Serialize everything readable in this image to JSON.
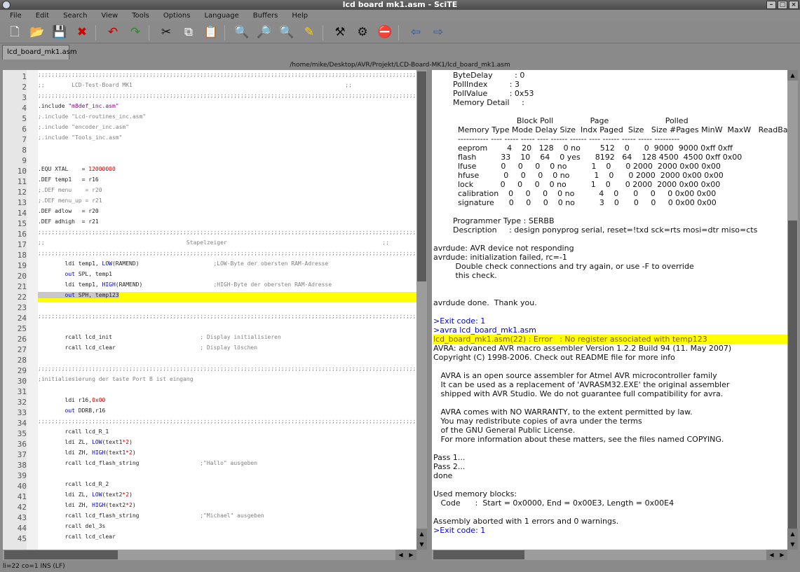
{
  "window": {
    "title": "lcd board mk1.asm - SciTE"
  },
  "menu": [
    "File",
    "Edit",
    "Search",
    "View",
    "Tools",
    "Options",
    "Language",
    "Buffers",
    "Help"
  ],
  "toolbar": [
    "new-file",
    "open-file",
    "save-file",
    "close-file",
    "undo",
    "redo",
    "cut",
    "copy",
    "paste",
    "find",
    "find-next",
    "find-in-files",
    "replace",
    "compile",
    "build",
    "stop",
    "prev-buffer",
    "next-buffer"
  ],
  "tab": {
    "label": "lcd_board_mk1.asm"
  },
  "path": "/home/mike/Desktop/AVR/Projekt/LCD-Board-MK1/lcd_board_mk1.asm",
  "editor": {
    "lines": [
      {
        "n": "1",
        "t": ";;;;;;;;;;;;;;;;;;;;;;;;;;;;;;;;;;;;;;;;;;;;;;;;;;;;;;;;;;;;;;;;;;;;;;;;;;;;;;;;;;;;;;;;;;;;;;;;;;;;;;;;;;;;;;;;;;;;;;;",
        "c": "cm"
      },
      {
        "n": "2",
        "t": ";;        LCD-Test-Board MK1                                                               ;;",
        "c": "cm"
      },
      {
        "n": "3",
        "t": ";;;;;;;;;;;;;;;;;;;;;;;;;;;;;;;;;;;;;;;;;;;;;;;;;;;;;;;;;;;;;;;;;;;;;;;;;;;;;;;;;;;;;;;;;;;;;;;;;;;;;;;;;;;;;;;;;;;;;;;",
        "c": "cm"
      },
      {
        "n": "4",
        "p1": ".include ",
        "p2": "\"m8def_inc.asm\"",
        "c": "inc"
      },
      {
        "n": "5",
        "t": ";.include \"Lcd-routines_inc.asm\"",
        "c": "cm"
      },
      {
        "n": "6",
        "t": ";.include \"encoder_inc.asm\"",
        "c": "cm"
      },
      {
        "n": "7",
        "t": ";.include \"Tools_inc.asm\"",
        "c": "cm"
      },
      {
        "n": "8",
        "t": "",
        "c": ""
      },
      {
        "n": "9",
        "t": "",
        "c": ""
      },
      {
        "n": "10",
        "p1": ".EQU XTAL    = ",
        "p2": "12000000",
        "c": "equ"
      },
      {
        "n": "11",
        "t": ".DEF temp1   = r16",
        "c": "kw"
      },
      {
        "n": "12",
        "t": ";.DEF menu    = r20",
        "c": "cm"
      },
      {
        "n": "13",
        "t": ";.DEF menu_up = r21",
        "c": "cm"
      },
      {
        "n": "14",
        "t": ".DEF adlow   = r20",
        "c": "kw"
      },
      {
        "n": "15",
        "t": ".DEF adhigh  = r21",
        "c": "kw"
      },
      {
        "n": "16",
        "t": ";;;;;;;;;;;;;;;;;;;;;;;;;;;;;;;;;;;;;;;;;;;;;;;;;;;;;;;;;;;;;;;;;;;;;;;;;;;;;;;;;;;;;;;;;;;;;;;;;;;;;;;;;;;;;;;;;;;;;;;",
        "c": "cm"
      },
      {
        "n": "17",
        "t": ";;                                          Stapelzeiger                                              ;;",
        "c": "cm"
      },
      {
        "n": "18",
        "t": ";;;;;;;;;;;;;;;;;;;;;;;;;;;;;;;;;;;;;;;;;;;;;;;;;;;;;;;;;;;;;;;;;;;;;;;;;;;;;;;;;;;;;;;;;;;;;;;;;;;;;;;;;;;;;;;;;;;;;;;",
        "c": "cm"
      },
      {
        "n": "19",
        "p1": "        ldi temp1, ",
        "p2": "LOW",
        "p3": "(RAMEND)                      ",
        "p4": ";LOW-Byte der obersten RAM-Adresse",
        "c": "ldi"
      },
      {
        "n": "20",
        "p1": "        ",
        "p2": "out",
        "p3": " SPL, temp1",
        "c": "out"
      },
      {
        "n": "21",
        "p1": "        ldi temp1, ",
        "p2": "HIGH",
        "p3": "(RAMEND)                     ",
        "p4": ";HIGH-Byte der obersten RAM-Adresse",
        "c": "ldi"
      },
      {
        "n": "22",
        "p1": "        ",
        "p2": "out",
        "p3": " SPH, temp123",
        "c": "out",
        "hl": true
      },
      {
        "n": "23",
        "t": "",
        "c": ""
      },
      {
        "n": "24",
        "t": ";;;;;;;;;;;;;;;;;;;;;;;;;;;;;;;;;;;;;;;;;;;;;;;;;;;;;;;;;;;;;;;;;;;;;;;;;;;;;;;;;;;;;;;;;;;;;;;;;;;;;;;;;;;;;;;;;;;;;;;",
        "c": "cm"
      },
      {
        "n": "25",
        "t": "",
        "c": ""
      },
      {
        "n": "26",
        "p1": "        rcall lcd_init                          ",
        "p4": "; Display initialisieren",
        "c": "rc"
      },
      {
        "n": "27",
        "p1": "        rcall lcd_clear                         ",
        "p4": "; Display löschen",
        "c": "rc"
      },
      {
        "n": "28",
        "t": "",
        "c": ""
      },
      {
        "n": "29",
        "t": ";;;;;;;;;;;;;;;;;;;;;;;;;;;;;;;;;;;;;;;;;;;;;;;;;;;;;;;;;;;;;;;;;;;;;;;;;;;;;;;;;;;;;;;;;;;;;;;;;;;;;;;;;;;;;;;;;;;;;;;",
        "c": "cm"
      },
      {
        "n": "30",
        "t": ";initialiesierung der taste Port B ist eingang",
        "c": "cm"
      },
      {
        "n": "31",
        "t": "",
        "c": ""
      },
      {
        "n": "32",
        "p1": "        ldi r16,",
        "p2": "0x00",
        "c": "num"
      },
      {
        "n": "33",
        "p1": "        ",
        "p2": "out",
        "p3": " DDRB,r16",
        "c": "out"
      },
      {
        "n": "34",
        "t": ";;;;;;;;;;;;;;;;;;;;;;;;;;;;;;;;;;;;;;;;;;;;;;;;;;;;;;;;;;;;;;;;;;;;;;;;;;;;;;;;;;;;;;;;;;;;;;;;;;;;;;;;;;;;;;;;;;;;;;;",
        "c": "cm"
      },
      {
        "n": "35",
        "t": "        rcall lcd_R_1",
        "c": ""
      },
      {
        "n": "36",
        "p1": "        ldi ZL, ",
        "p2": "LOW",
        "p3": "(text1",
        "p5": "*2",
        "p6": ")",
        "c": "ldz"
      },
      {
        "n": "37",
        "p1": "        ldi ZH, ",
        "p2": "HIGH",
        "p3": "(text1",
        "p5": "*2",
        "p6": ")",
        "c": "ldz"
      },
      {
        "n": "38",
        "p1": "        rcall lcd_flash_string                  ",
        "p4": ";\"Hallo\" ausgeben",
        "c": "rc"
      },
      {
        "n": "39",
        "t": "",
        "c": ""
      },
      {
        "n": "40",
        "t": "        rcall lcd_R_2",
        "c": ""
      },
      {
        "n": "41",
        "p1": "        ldi ZL, ",
        "p2": "LOW",
        "p3": "(text2",
        "p5": "*2",
        "p6": ")",
        "c": "ldz"
      },
      {
        "n": "42",
        "p1": "        ldi ZH, ",
        "p2": "HIGH",
        "p3": "(text2",
        "p5": "*2",
        "p6": ")",
        "c": "ldz"
      },
      {
        "n": "43",
        "p1": "        rcall lcd_flash_string                  ",
        "p4": ";\"Michael\" ausgeben",
        "c": "rc"
      },
      {
        "n": "44",
        "t": "        rcall del_3s",
        "c": ""
      },
      {
        "n": "45",
        "t": "        rcall lcd_clear",
        "c": ""
      }
    ]
  },
  "output": {
    "lines": [
      {
        "t": "        ByteDelay         : 0",
        "c": ""
      },
      {
        "t": "        PollIndex         : 3",
        "c": ""
      },
      {
        "t": "        PollValue         : 0x53",
        "c": ""
      },
      {
        "t": "        Memory Detail     :",
        "c": ""
      },
      {
        "t": "",
        "c": ""
      },
      {
        "t": "                                  Block Poll               Page                       Polled",
        "c": ""
      },
      {
        "t": "          Memory Type Mode Delay Size  Indx Paged  Size   Size #Pages MinW  MaxW   ReadBack",
        "c": ""
      },
      {
        "t": "          ----------- ---- ----- ----- ---- ------ ------ ---- ------ ----- ----- ---------",
        "c": ""
      },
      {
        "t": "          eeprom        4    20   128    0 no        512    0      0  9000  9000 0xff 0xff",
        "c": ""
      },
      {
        "t": "          flash          33    10    64    0 yes      8192   64    128 4500  4500 0xff 0x00",
        "c": ""
      },
      {
        "t": "          lfuse          0     0     0    0 no          1    0      0 2000  2000 0x00 0x00",
        "c": ""
      },
      {
        "t": "          hfuse          0     0     0    0 no          1    0      0 2000  2000 0x00 0x00",
        "c": ""
      },
      {
        "t": "          lock           0     0     0    0 no          1    0      0 2000  2000 0x00 0x00",
        "c": ""
      },
      {
        "t": "          calibration    0     0     0    0 no          4    0      0     0     0 0x00 0x00",
        "c": ""
      },
      {
        "t": "          signature      0     0     0    0 no          3    0      0     0     0 0x00 0x00",
        "c": ""
      },
      {
        "t": "",
        "c": ""
      },
      {
        "t": "        Programmer Type : SERBB",
        "c": ""
      },
      {
        "t": "        Description     : design ponyprog serial, reset=!txd sck=rts mosi=dtr miso=cts",
        "c": ""
      },
      {
        "t": "",
        "c": ""
      },
      {
        "t": "avrdude: AVR device not responding",
        "c": ""
      },
      {
        "t": "avrdude: initialization failed, rc=-1",
        "c": ""
      },
      {
        "t": "         Double check connections and try again, or use -F to override",
        "c": ""
      },
      {
        "t": "         this check.",
        "c": ""
      },
      {
        "t": "",
        "c": ""
      },
      {
        "t": "",
        "c": ""
      },
      {
        "t": "avrdude done.  Thank you.",
        "c": ""
      },
      {
        "t": "",
        "c": ""
      },
      {
        "t": ">Exit code: 1",
        "c": "ex"
      },
      {
        "t": ">avra lcd_board_mk1.asm",
        "c": "ex"
      },
      {
        "t": "lcd_board_mk1.asm(22) : Error   : No register associated with temp123",
        "c": "err"
      },
      {
        "t": "AVRA: advanced AVR macro assembler Version 1.2.2 Build 94 (11. May 2007)",
        "c": ""
      },
      {
        "t": "Copyright (C) 1998-2006. Check out README file for more info",
        "c": ""
      },
      {
        "t": "",
        "c": ""
      },
      {
        "t": "   AVRA is an open source assembler for Atmel AVR microcontroller family",
        "c": ""
      },
      {
        "t": "   It can be used as a replacement of 'AVRASM32.EXE' the original assembler",
        "c": ""
      },
      {
        "t": "   shipped with AVR Studio. We do not guarantee full compatibility for avra.",
        "c": ""
      },
      {
        "t": "",
        "c": ""
      },
      {
        "t": "   AVRA comes with NO WARRANTY, to the extent permitted by law.",
        "c": ""
      },
      {
        "t": "   You may redistribute copies of avra under the terms",
        "c": ""
      },
      {
        "t": "   of the GNU General Public License.",
        "c": ""
      },
      {
        "t": "   For more information about these matters, see the files named COPYING.",
        "c": ""
      },
      {
        "t": "",
        "c": ""
      },
      {
        "t": "Pass 1...",
        "c": ""
      },
      {
        "t": "Pass 2...",
        "c": ""
      },
      {
        "t": "done",
        "c": ""
      },
      {
        "t": "",
        "c": ""
      },
      {
        "t": "Used memory blocks:",
        "c": ""
      },
      {
        "t": "   Code      :  Start = 0x0000, End = 0x00E3, Length = 0x00E4",
        "c": ""
      },
      {
        "t": "",
        "c": ""
      },
      {
        "t": "Assembly aborted with 1 errors and 0 warnings.",
        "c": ""
      },
      {
        "t": ">Exit code: 1",
        "c": "ex"
      }
    ]
  },
  "status": "li=22 co=1 INS (LF)"
}
